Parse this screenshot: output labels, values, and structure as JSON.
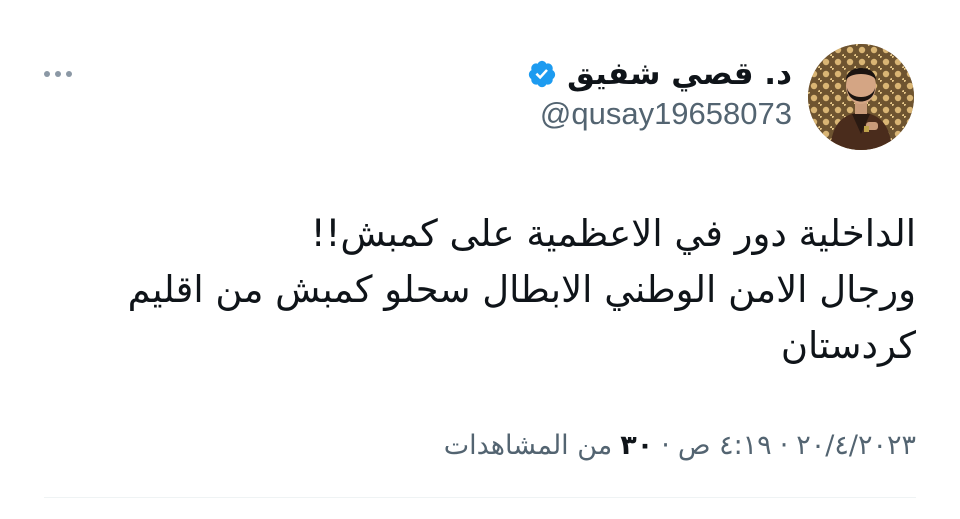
{
  "author": {
    "display_name": "د. قصي شفيق",
    "handle": "@qusay19658073",
    "verified": true,
    "avatar_icon": "profile-photo",
    "verified_icon": "verified-badge-icon",
    "verified_color": "#1d9bf0"
  },
  "tweet": {
    "lines": [
      "الداخلية دور في الاعظمية على كمبش!!",
      "ورجال الامن الوطني الابطال سحلو كمبش من اقليم",
      "كردستان"
    ]
  },
  "meta": {
    "date": "٢٠/٤/٢٠٢٣",
    "time": "٤:١٩ ص",
    "views_count": "٣٠",
    "views_label": "من المشاهدات",
    "separator": "·"
  },
  "more_icon": "more-horizontal-icon"
}
